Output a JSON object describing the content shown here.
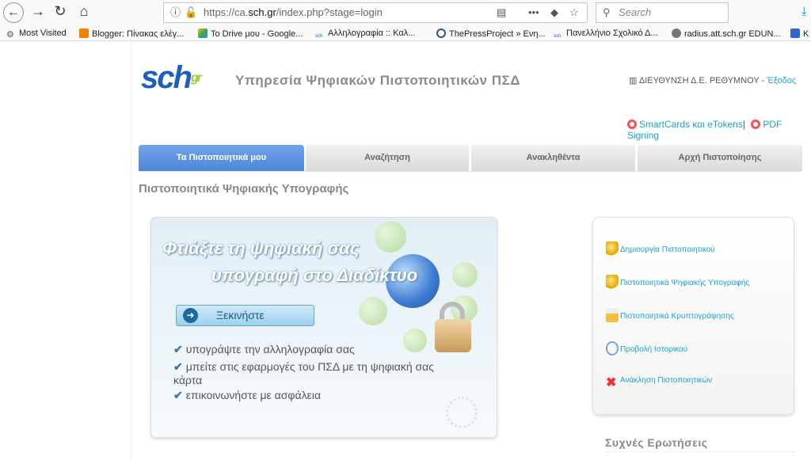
{
  "browser": {
    "url_prefix": "https://ca.",
    "url_domain": "sch.gr",
    "url_path": "/index.php?stage=login",
    "search_placeholder": "Search",
    "bookmarks": [
      {
        "label": "Most Visited"
      },
      {
        "label": "Blogger: Πίνακας ελέγ..."
      },
      {
        "label": "Το Drive μου - Google..."
      },
      {
        "label": "Αλληλογραφία :: Καλ..."
      },
      {
        "label": "ThePressProject » Ενη..."
      },
      {
        "label": "Πανελλήνιο Σχολικό Δ..."
      },
      {
        "label": "radius.att.sch.gr EDUN..."
      },
      {
        "label": "K"
      }
    ]
  },
  "header": {
    "logo": "sch.gr",
    "title": "Υπηρεσία Ψηφιακών Πιστοποιητικών ΠΣΔ",
    "org": "ΔΙΕΥΘΥΝΣΗ Δ.Ε. ΡΕΘΥΜΝΟΥ",
    "separator": " - ",
    "logout": "Έξοδος",
    "link_smartcards": "SmartCards και eTokens",
    "link_sep": "|",
    "link_pdf": "PDF Signing"
  },
  "tabs": [
    {
      "label": "Τα Πιστοποιητικά μου",
      "active": true
    },
    {
      "label": "Αναζήτηση"
    },
    {
      "label": "Ανακληθέντα"
    },
    {
      "label": "Αρχή Πιστοποίησης"
    }
  ],
  "main": {
    "heading": "Πιστοποιητικά Ψηφιακής Υπογραφής",
    "banner": {
      "line1": "Φτιάξτε τη ψηφιακή σας",
      "line2": "υπογραφή στο Διαδίκτυο",
      "start": "Ξεκινήστε",
      "checks": [
        "υπογράψτε την αλληλογραφία σας",
        "μπείτε στις εφαρμογές του ΠΣΔ με τη ψηφιακή σας κάρτα",
        "επικοινωνήστε με ασφάλεια"
      ]
    },
    "side": [
      {
        "label": "Δημιουργία Πιστοποιητικού",
        "icon": "certificate-add-icon"
      },
      {
        "label": "Πιστοποιητικά Ψηφιακής Υπογραφής",
        "icon": "certificate-icon"
      },
      {
        "label": "Πιστοποιητικά Κρυπτογράφησης",
        "icon": "lock-certificate-icon"
      },
      {
        "label": "Προβολή Ιστορικού",
        "icon": "history-clock-icon"
      },
      {
        "label": "Ανάκληση Πιστοποιητικών",
        "icon": "revoke-icon"
      }
    ],
    "faq": "Συχνές Ερωτήσεις"
  }
}
